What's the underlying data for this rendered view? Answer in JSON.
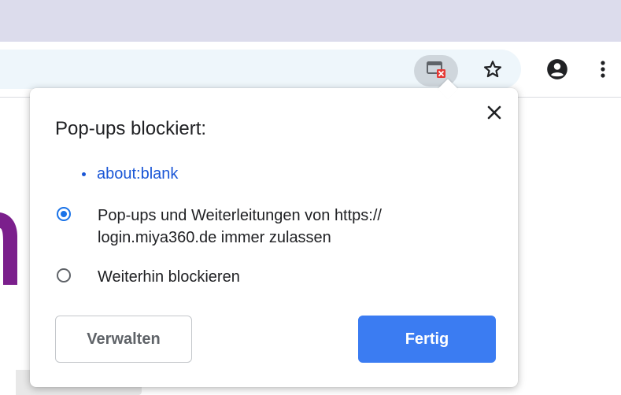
{
  "popup": {
    "title": "Pop-ups blockiert:",
    "blocked_links": [
      "about:blank"
    ],
    "options": [
      {
        "label": "Pop-ups und Weiterleitungen von https:// login.miya360.de immer zulassen",
        "selected": true
      },
      {
        "label": "Weiterhin blockieren",
        "selected": false
      }
    ],
    "manage_label": "Verwalten",
    "done_label": "Fertig",
    "close_glyph": "✕"
  },
  "toolbar": {
    "icons": [
      "popup-blocked-icon",
      "star-icon",
      "account-icon",
      "more-vert-icon"
    ]
  },
  "colors": {
    "accent": "#1a73e8",
    "primary_button": "#3b7cf2",
    "link": "#1a56d6",
    "tabstrip": "#dcdcec",
    "blocked_badge": "#e53935",
    "logo_purple": "#7b1f8c"
  }
}
